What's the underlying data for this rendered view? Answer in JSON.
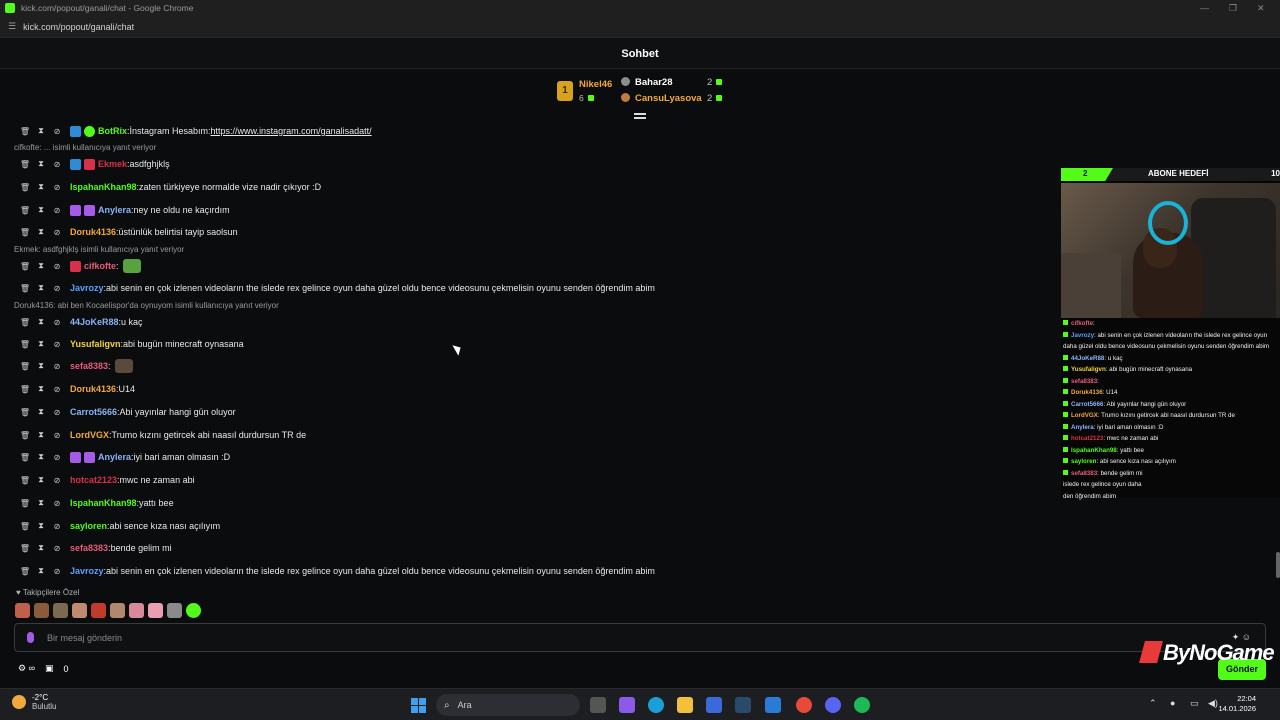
{
  "window": {
    "title": "kick.com/popout/ganali/chat - Google Chrome",
    "url": "kick.com/popout/ganali/chat"
  },
  "chat": {
    "header": "Sohbet",
    "leaderboard": {
      "first": {
        "name": "Nikel46",
        "count": "6",
        "rank": "1"
      },
      "second": {
        "name": "Bahar28",
        "count": "2"
      },
      "third": {
        "name": "CansuLyasova",
        "count": "2"
      }
    },
    "messages": [
      {
        "type": "msg",
        "badges": [
          "bot",
          "verified"
        ],
        "user": "BotRix",
        "color": "#53fc18",
        "text": "İnstagram Hesabım: ",
        "link": "https://www.instagram.com/ganalisadatt/"
      },
      {
        "type": "reply",
        "text": "cifkofte: ... isimli kullanıcıya yanıt veriyor"
      },
      {
        "type": "msg",
        "badges": [
          "bot",
          "red"
        ],
        "user": "Ekmek",
        "color": "#d9304a",
        "text": "asdfghjklş"
      },
      {
        "type": "msg",
        "badges": [],
        "user": "IspahanKhan98",
        "color": "#53fc18",
        "text": "zaten türkiyeye normalde vize nadir çıkıyor :D"
      },
      {
        "type": "msg",
        "badges": [
          "purple",
          "purple"
        ],
        "user": "Anylera",
        "color": "#8ab4f8",
        "text": "ney ne oldu ne kaçırdım"
      },
      {
        "type": "msg",
        "badges": [],
        "user": "Doruk4136",
        "color": "#f2a93b",
        "text": "üstünlük belirtisi tayip saolsun"
      },
      {
        "type": "reply",
        "text": "Ekmek: asdfghjklş isimli kullanıcıya yanıt veriyor"
      },
      {
        "type": "msg",
        "badges": [
          "red"
        ],
        "user": "cifkofte",
        "color": "#e65c7b",
        "text": "",
        "emote": "frog"
      },
      {
        "type": "msg",
        "badges": [],
        "user": "Javrozy",
        "color": "#5aa0ff",
        "text": "abi senin en çok izlenen videoların the islede rex gelince oyun daha güzel oldu bence videosunu çekmelisin oyunu senden öğrendim abim"
      },
      {
        "type": "reply",
        "text": "Doruk4136: abi ben Kocaelispor'da oynuyom isimli kullanıcıya yanıt veriyor"
      },
      {
        "type": "msg",
        "badges": [],
        "user": "44JoKeR88",
        "color": "#8ab4f8",
        "text": "u kaç"
      },
      {
        "type": "msg",
        "badges": [],
        "user": "Yusufaligvn",
        "color": "#f2d43b",
        "text": "abi bugün minecraft oynasana"
      },
      {
        "type": "msg",
        "badges": [],
        "user": "sefa8383",
        "color": "#e65c7b",
        "text": "",
        "emote": "face"
      },
      {
        "type": "msg",
        "badges": [],
        "user": "Doruk4136",
        "color": "#f2a93b",
        "text": "U14"
      },
      {
        "type": "msg",
        "badges": [],
        "user": "Carrot5666",
        "color": "#8ab4f8",
        "text": "Abi yayınlar hangi gün oluyor"
      },
      {
        "type": "msg",
        "badges": [],
        "user": "LordVGX",
        "color": "#f2a93b",
        "text": "Trumo kızını getircek abi naasıl durdursun TR de"
      },
      {
        "type": "msg",
        "badges": [
          "purple",
          "purple"
        ],
        "user": "Anylera",
        "color": "#8ab4f8",
        "text": "iyi bari aman olmasın :D"
      },
      {
        "type": "msg",
        "badges": [],
        "user": "hotcat2123",
        "color": "#d9304a",
        "text": "mwc ne zaman abi"
      },
      {
        "type": "msg",
        "badges": [],
        "user": "IspahanKhan98",
        "color": "#53fc18",
        "text": "yattı bee"
      },
      {
        "type": "msg",
        "badges": [],
        "user": "sayloren",
        "color": "#53fc18",
        "text": "abi sence kıza nası açılıyım"
      },
      {
        "type": "msg",
        "badges": [],
        "user": "sefa8383",
        "color": "#e65c7b",
        "text": "bende gelim mi"
      },
      {
        "type": "msg",
        "badges": [],
        "user": "Javrozy",
        "color": "#5aa0ff",
        "text": "abi senin en çok izlenen videoların the islede rex gelince oyun daha güzel oldu bence videosunu çekmelisin oyunu senden öğrendim abim"
      }
    ],
    "followers_label": "Takipçilere Özel",
    "input_placeholder": "Bir mesaj gönderin",
    "viewer_count": "0",
    "send_label": "Gönder"
  },
  "overlay": {
    "goal_label": "ABONE HEDEFİ",
    "goal_current": "2",
    "goal_target": "10",
    "lines": [
      {
        "user": "cifkofte",
        "color": "#e65c7b",
        "text": ":"
      },
      {
        "user": "Javrozy",
        "color": "#5aa0ff",
        "text": ": abi senin en çok izlenen videoların the islede rex gelince oyun daha güzel oldu bence videosunu çekmelisin oyunu senden öğrendim abim"
      },
      {
        "user": "44JoKeR88",
        "color": "#8ab4f8",
        "text": ": u kaç"
      },
      {
        "user": "Yusufaligvn",
        "color": "#f2d43b",
        "text": ": abi bugün minecraft oynasana"
      },
      {
        "user": "sefa8383",
        "color": "#e65c7b",
        "text": ":"
      },
      {
        "user": "Doruk4136",
        "color": "#f2a93b",
        "text": ": U14"
      },
      {
        "user": "Carrot5666",
        "color": "#8ab4f8",
        "text": ": Abi yayınlar hangi gün oluyor"
      },
      {
        "user": "LordVGX",
        "color": "#f2a93b",
        "text": ": Trumo kızını getircek abi naasıl durdursun TR de"
      },
      {
        "user": "Anylera",
        "color": "#8ab4f8",
        "text": ": iyi bari aman olmasın :D"
      },
      {
        "user": "hotcat2123",
        "color": "#d9304a",
        "text": ": mwc ne zaman abi"
      },
      {
        "user": "IspahanKhan98",
        "color": "#53fc18",
        "text": ": yattı bee"
      },
      {
        "user": "sayloren",
        "color": "#53fc18",
        "text": ": abi sence kıza nası açılıyım"
      },
      {
        "user": "sefa8383",
        "color": "#e65c7b",
        "text": ": bende gelim mi"
      }
    ],
    "tail_1": "islede rex gelince oyun daha",
    "tail_2": "den öğrendim abim",
    "brand": "ByNoGame"
  },
  "taskbar": {
    "temperature": "-2°C",
    "weather": "Bulutlu",
    "search_placeholder": "Ara",
    "time": "22:04",
    "date": "14.01.2026"
  },
  "colors": {
    "accent": "#53fc18",
    "background": "#0b0c0d"
  }
}
